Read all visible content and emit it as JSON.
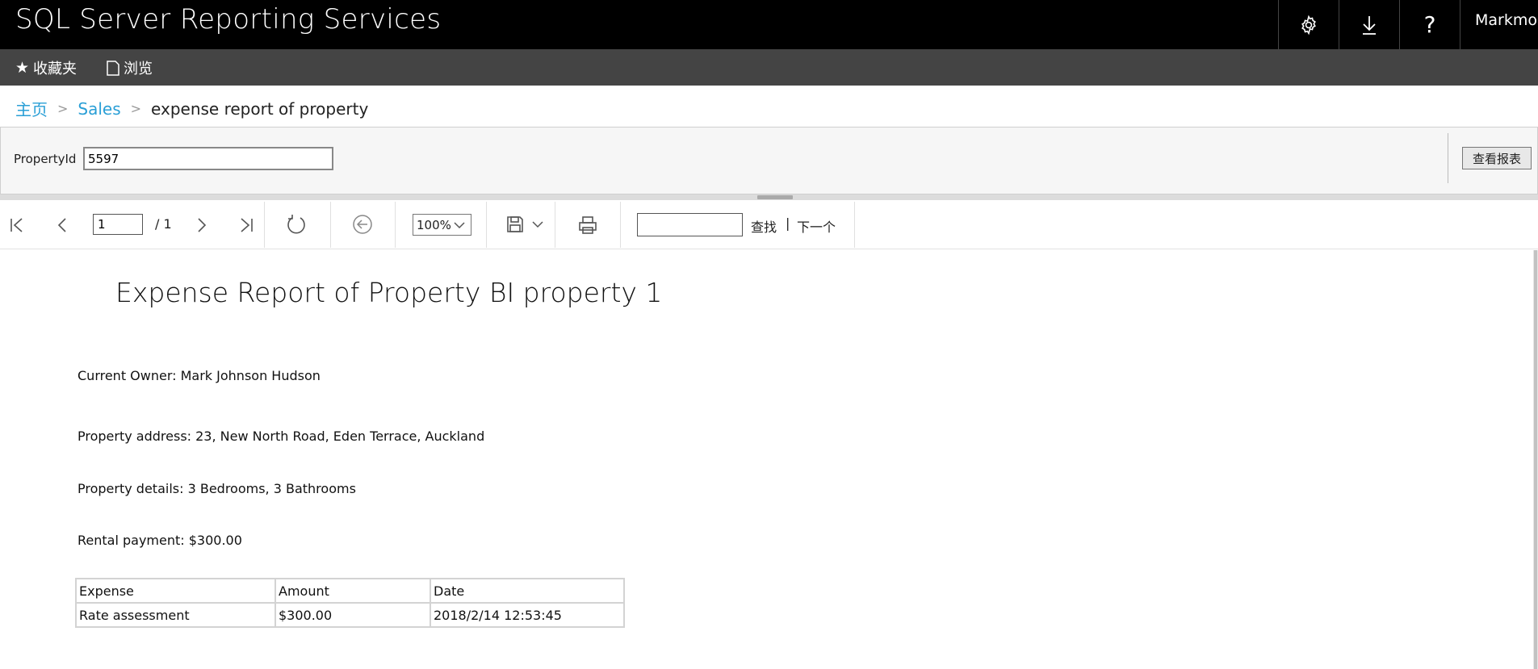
{
  "header": {
    "app_title": "SQL Server Reporting Services",
    "settings_icon": "gear-icon",
    "download_icon": "download-arrow-icon",
    "help_label": "?",
    "user_name": "Markmo"
  },
  "subnav": {
    "favorites_label": "收藏夹",
    "browse_label": "浏览"
  },
  "breadcrumb": {
    "home": "主页",
    "folder": "Sales",
    "current": "expense report of property"
  },
  "parameters": {
    "label": "PropertyId",
    "value": "5597",
    "view_report_button": "查看报表"
  },
  "toolbar": {
    "current_page": "1",
    "total_pages": "/ 1",
    "zoom": "100%",
    "find_value": "",
    "find_label": "查找",
    "separator": "|",
    "next_label": "下一个"
  },
  "report": {
    "title": "Expense Report of Property BI property 1",
    "owner": "Current Owner: Mark Johnson Hudson",
    "address": "Property address: 23, New North Road, Eden Terrace, Auckland",
    "details": "Property details: 3 Bedrooms, 3 Bathrooms",
    "rental": "Rental payment: $300.00",
    "table": {
      "headers": [
        "Expense",
        "Amount",
        "Date"
      ],
      "rows": [
        [
          "Rate assessment",
          "$300.00",
          "2018/2/14 12:53:45"
        ]
      ]
    }
  }
}
